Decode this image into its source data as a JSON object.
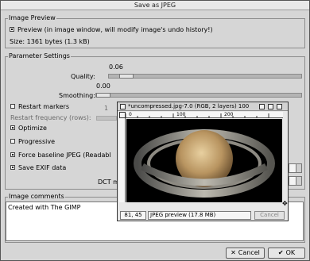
{
  "dialog": {
    "title": "Save as JPEG"
  },
  "image_preview": {
    "section_label": "Image Preview",
    "preview_checkbox_label": "Preview (in image window, will modify image's undo history!)",
    "preview_checked": true,
    "size_text": "Size: 1361 bytes (1.3 kB)"
  },
  "parameter_settings": {
    "section_label": "Parameter Settings",
    "quality": {
      "label": "Quality:",
      "value": "0.06",
      "fraction": 0.06
    },
    "smoothing": {
      "label": "Smoothing:",
      "value": "0.00",
      "fraction": 0.0
    },
    "restart_markers": {
      "label": "Restart markers",
      "checked": false
    },
    "restart_frequency": {
      "label": "Restart frequency (rows):",
      "value": "1"
    },
    "optimize": {
      "label": "Optimize",
      "checked": true
    },
    "progressive": {
      "label": "Progressive",
      "checked": false
    },
    "force_baseline": {
      "label": "Force baseline JPEG (Readabl",
      "checked": true
    },
    "save_exif": {
      "label": "Save EXIF data",
      "checked": true
    },
    "dct_label": "DCT m"
  },
  "image_comments": {
    "section_label": "Image comments",
    "text": "Created with The GIMP"
  },
  "buttons": {
    "cancel_label": "Cancel",
    "ok_label": "OK"
  },
  "image_window": {
    "title": "*uncompressed.jpg-7.0 (RGB, 2 layers) 100",
    "ruler_ticks": [
      "0",
      "100",
      "200"
    ],
    "coords": "81, 45",
    "status": "JPEG preview (17.8 MB)",
    "cancel_label": "Cancel"
  }
}
